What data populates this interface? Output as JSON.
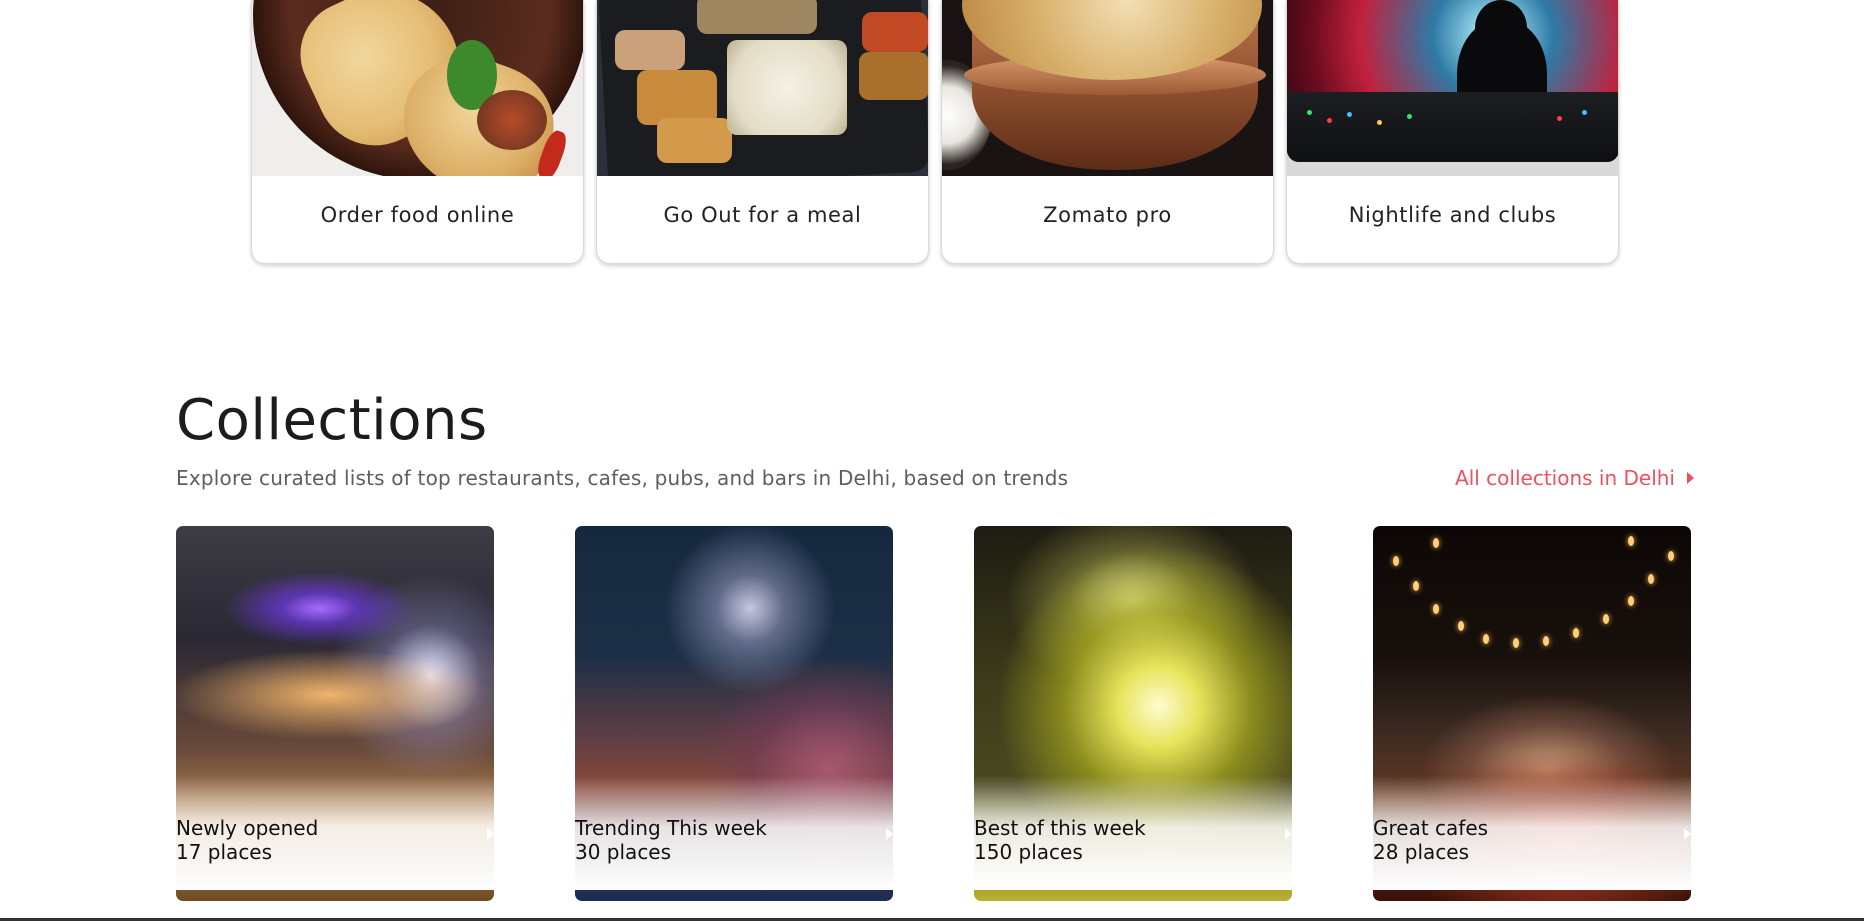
{
  "categories": [
    {
      "label": "Order food online",
      "image": "wraps-image"
    },
    {
      "label": "Go Out for a meal",
      "image": "thali-image"
    },
    {
      "label": "Zomato pro",
      "image": "biryani-image"
    },
    {
      "label": "Nightlife and clubs",
      "image": "dj-image"
    }
  ],
  "collections": {
    "title": "Collections",
    "subtitle": "Explore curated lists of top restaurants, cafes, pubs, and bars in Delhi, based on trends",
    "all_link": "All collections in Delhi",
    "items": [
      {
        "name": "Newly opened",
        "count": "17 places"
      },
      {
        "name": "Trending This week",
        "count": "30 places"
      },
      {
        "name": "Best of this week",
        "count": "150 places"
      },
      {
        "name": "Great cafes",
        "count": "28 places"
      }
    ]
  },
  "colors": {
    "accent": "#ef4f5f",
    "text": "#1c1c1c",
    "muted": "#5e5e5e"
  }
}
